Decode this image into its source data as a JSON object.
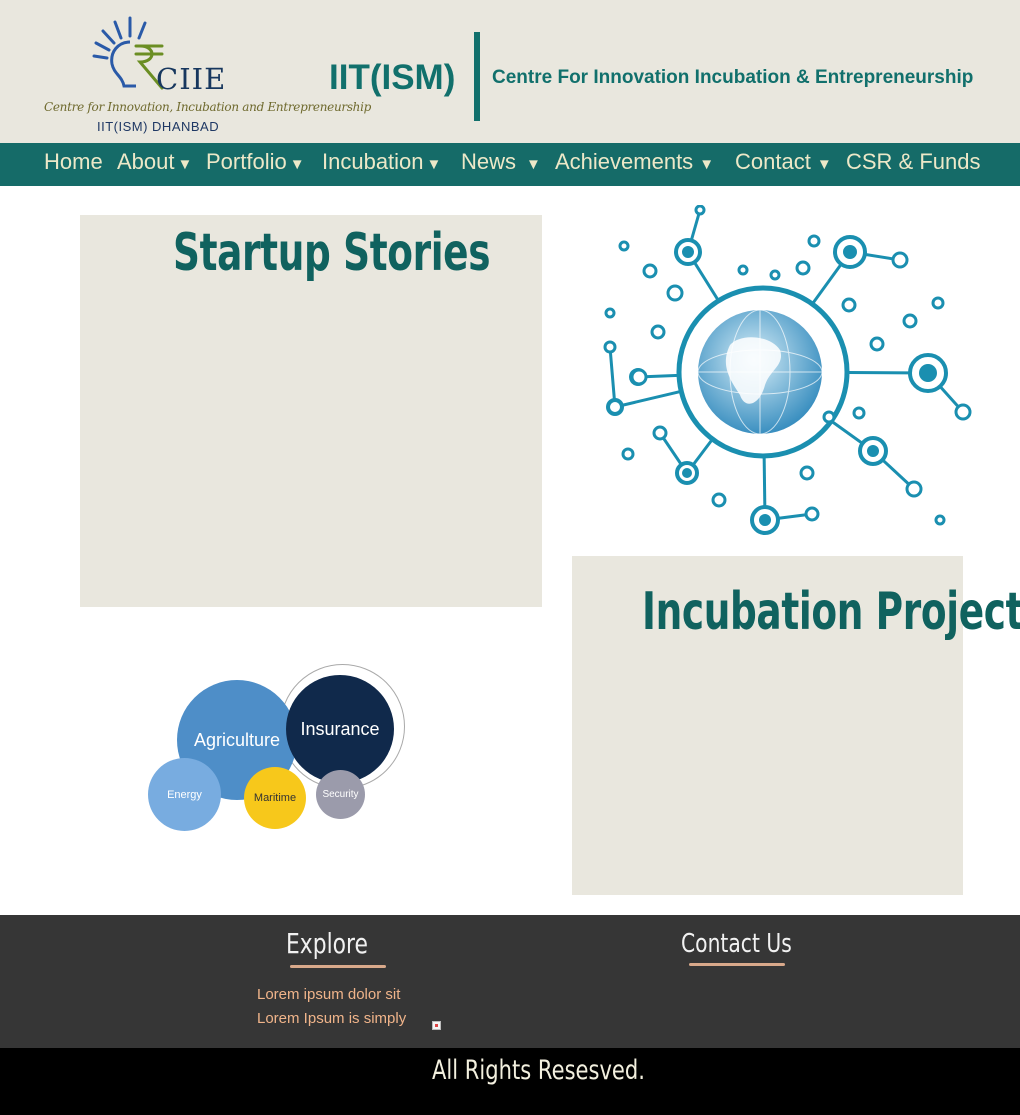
{
  "header": {
    "logo_word": "CIIE",
    "logo_subtitle": "Centre for Innovation, Incubation and Entrepreneurship",
    "logo_place": "IIT(ISM) DHANBAD",
    "title": "IIT(ISM)",
    "tagline": "Centre For Innovation Incubation & Entrepreneurship"
  },
  "nav": {
    "items": [
      {
        "label": "Home",
        "caret": ""
      },
      {
        "label": "About",
        "caret": "▼"
      },
      {
        "label": "Portfolio",
        "caret": "▼"
      },
      {
        "label": "Incubation",
        "caret": "▼"
      },
      {
        "label": "News",
        "caret": "▼"
      },
      {
        "label": "Achievements",
        "caret": "▼"
      },
      {
        "label": "Contact",
        "caret": "▼"
      },
      {
        "label": "CSR & Funds",
        "caret": ""
      }
    ]
  },
  "main": {
    "startup_title": "Startup Stories",
    "incubation_title": "Incubation Projects",
    "bubbles": [
      "Agriculture",
      "Insurance",
      "Energy",
      "Maritime",
      "Security"
    ]
  },
  "footer": {
    "explore_title": "Explore",
    "explore_links": [
      "Lorem ipsum dolor sit",
      "Lorem Ipsum is simply"
    ],
    "contact_title": "Contact Us",
    "copyright": "All Rights Resesved."
  },
  "colors": {
    "teal": "#156b68",
    "panel": "#e9e7de",
    "footer": "#363636",
    "network": "#1a8fb0"
  }
}
